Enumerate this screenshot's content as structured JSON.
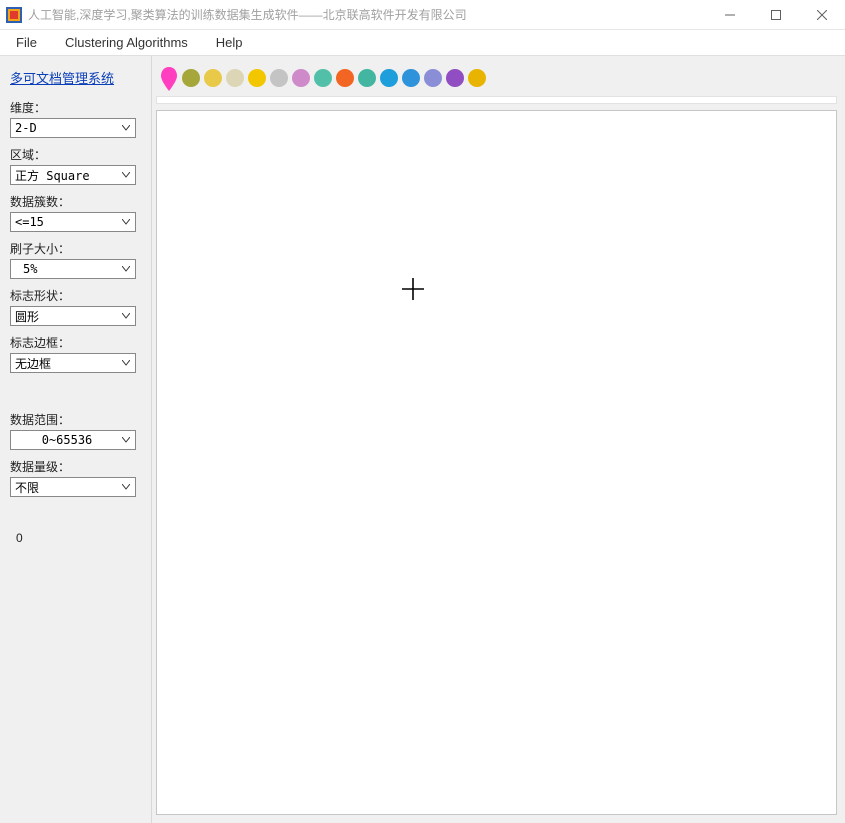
{
  "window": {
    "title": "人工智能,深度学习,聚类算法的训练数据集生成软件——北京联高软件开发有限公司"
  },
  "menu": {
    "file": "File",
    "clustering": "Clustering Algorithms",
    "help": "Help"
  },
  "sidebar": {
    "top_link": "多可文档管理系统",
    "fields": {
      "dimension": {
        "label": "维度：",
        "value": "2-D"
      },
      "region": {
        "label": "区域：",
        "value": "正方 Square"
      },
      "clusters": {
        "label": "数据簇数：",
        "value": "<=15"
      },
      "brush": {
        "label": "刷子大小：",
        "value": "5%"
      },
      "shape": {
        "label": "标志形状：",
        "value": "圆形"
      },
      "border": {
        "label": "标志边框：",
        "value": "无边框"
      },
      "range": {
        "label": "数据范围：",
        "value": "0~65536"
      },
      "magnitude": {
        "label": "数据量级：",
        "value": "不限"
      }
    },
    "counter": "0"
  },
  "palette": {
    "marker_color": "#ff3fbf",
    "colors": [
      "#a5a73a",
      "#e8c948",
      "#dcd6b6",
      "#f2c700",
      "#c4c4c4",
      "#cf8ac9",
      "#52bfa9",
      "#f26522",
      "#42b6a0",
      "#1e9edb",
      "#2f93db",
      "#8a8ed6",
      "#914ec2",
      "#e8b400"
    ]
  },
  "icons": {
    "chevron": "chevron-down-icon",
    "minimize": "minimize-icon",
    "maximize": "maximize-icon",
    "close": "close-icon",
    "crosshair": "crosshair-icon",
    "marker": "marker-icon"
  }
}
